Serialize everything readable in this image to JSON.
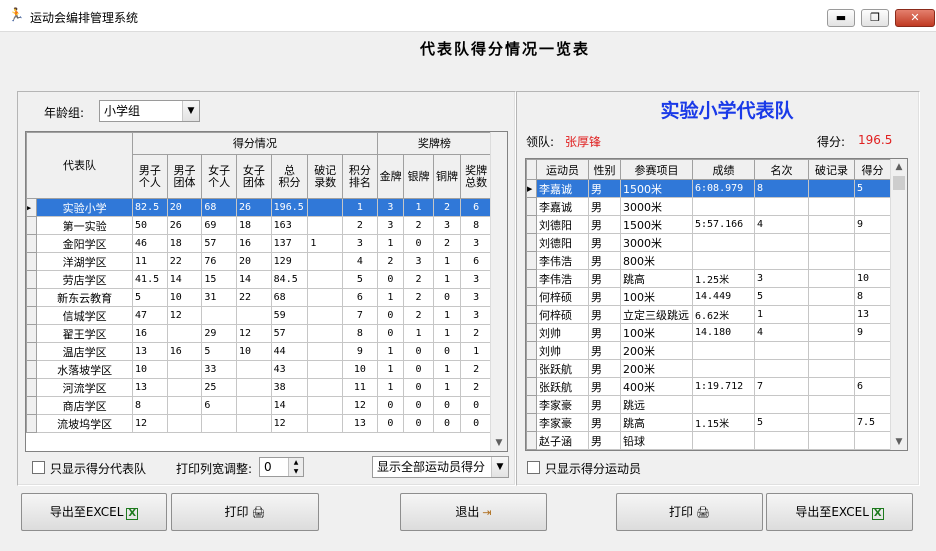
{
  "window": {
    "title": "运动会编排管理系统",
    "min": "▬",
    "max": "❐",
    "close": "✕"
  },
  "heading": "代表队得分情况一览表",
  "left": {
    "age_label": "年龄组:",
    "age_value": "小学组",
    "col_team": "代表队",
    "group_score": "得分情况",
    "group_medal": "奖牌榜",
    "cols": [
      "男子\n个人",
      "男子\n团体",
      "女子\n个人",
      "女子\n团体",
      "总\n积分",
      "破记\n录数",
      "积分\n排名",
      "金牌",
      "银牌",
      "铜牌",
      "奖牌\n总数"
    ],
    "rows": [
      [
        "实验小学",
        "82.5",
        "20",
        "68",
        "26",
        "196.5",
        "",
        "1",
        "3",
        "1",
        "2",
        "6"
      ],
      [
        "第一实验",
        "50",
        "26",
        "69",
        "18",
        "163",
        "",
        "2",
        "3",
        "2",
        "3",
        "8"
      ],
      [
        "金阳学区",
        "46",
        "18",
        "57",
        "16",
        "137",
        "1",
        "3",
        "1",
        "0",
        "2",
        "3"
      ],
      [
        "洋湖学区",
        "11",
        "22",
        "76",
        "20",
        "129",
        "",
        "4",
        "2",
        "3",
        "1",
        "6"
      ],
      [
        "劳店学区",
        "41.5",
        "14",
        "15",
        "14",
        "84.5",
        "",
        "5",
        "0",
        "2",
        "1",
        "3"
      ],
      [
        "新东云教育",
        "5",
        "10",
        "31",
        "22",
        "68",
        "",
        "6",
        "1",
        "2",
        "0",
        "3"
      ],
      [
        "信城学区",
        "47",
        "12",
        "",
        "",
        "59",
        "",
        "7",
        "0",
        "2",
        "1",
        "3"
      ],
      [
        "翟王学区",
        "16",
        "",
        "29",
        "12",
        "57",
        "",
        "8",
        "0",
        "1",
        "1",
        "2"
      ],
      [
        "温店学区",
        "13",
        "16",
        "5",
        "10",
        "44",
        "",
        "9",
        "1",
        "0",
        "0",
        "1"
      ],
      [
        "水落坡学区",
        "10",
        "",
        "33",
        "",
        "43",
        "",
        "10",
        "1",
        "0",
        "1",
        "2"
      ],
      [
        "河流学区",
        "13",
        "",
        "25",
        "",
        "38",
        "",
        "11",
        "1",
        "0",
        "1",
        "2"
      ],
      [
        "商店学区",
        "8",
        "",
        "6",
        "",
        "14",
        "",
        "12",
        "0",
        "0",
        "0",
        "0"
      ],
      [
        "流坡坞学区",
        "12",
        "",
        "",
        "",
        "12",
        "",
        "13",
        "0",
        "0",
        "0",
        "0"
      ]
    ],
    "only_scored_label": "只显示得分代表队",
    "print_width_label": "打印列宽调整:",
    "print_width_value": "0",
    "show_filter_value": "显示全部运动员得分"
  },
  "right": {
    "team_title": "实验小学代表队",
    "leader_label": "领队:",
    "leader_name": "张厚锋",
    "score_label": "得分:",
    "score_value": "196.5",
    "cols": [
      "运动员",
      "性别",
      "参赛项目",
      "成绩",
      "名次",
      "破记录",
      "得分"
    ],
    "rows": [
      [
        "李嘉诚",
        "男",
        "1500米",
        "6:08.979",
        "8",
        "",
        "5"
      ],
      [
        "李嘉诚",
        "男",
        "3000米",
        "",
        "",
        "",
        ""
      ],
      [
        "刘德阳",
        "男",
        "1500米",
        "5:57.166",
        "4",
        "",
        "9"
      ],
      [
        "刘德阳",
        "男",
        "3000米",
        "",
        "",
        "",
        ""
      ],
      [
        "李伟浩",
        "男",
        "800米",
        "",
        "",
        "",
        ""
      ],
      [
        "李伟浩",
        "男",
        "跳高",
        "1.25米",
        "3",
        "",
        "10"
      ],
      [
        "何梓硕",
        "男",
        "100米",
        "14.449",
        "5",
        "",
        "8"
      ],
      [
        "何梓硕",
        "男",
        "立定三级跳远",
        "6.62米",
        "1",
        "",
        "13"
      ],
      [
        "刘帅",
        "男",
        "100米",
        "14.180",
        "4",
        "",
        "9"
      ],
      [
        "刘帅",
        "男",
        "200米",
        "",
        "",
        "",
        ""
      ],
      [
        "张跃航",
        "男",
        "200米",
        "",
        "",
        "",
        ""
      ],
      [
        "张跃航",
        "男",
        "400米",
        "1:19.712",
        "7",
        "",
        "6"
      ],
      [
        "李家豪",
        "男",
        "跳远",
        "",
        "",
        "",
        ""
      ],
      [
        "李家豪",
        "男",
        "跳高",
        "1.15米",
        "5",
        "",
        "7.5"
      ],
      [
        "赵子涵",
        "男",
        "铅球",
        "",
        "",
        "",
        ""
      ]
    ],
    "only_scored_label": "只显示得分运动员"
  },
  "buttons": {
    "export_left": "导出至EXCEL",
    "print_left": "打印",
    "exit": "退出",
    "print_right": "打印",
    "export_right": "导出至EXCEL"
  },
  "icons": {
    "app": "athlete-icon",
    "excel": "excel-icon",
    "printer": "printer-icon",
    "exit": "exit-door-icon"
  }
}
